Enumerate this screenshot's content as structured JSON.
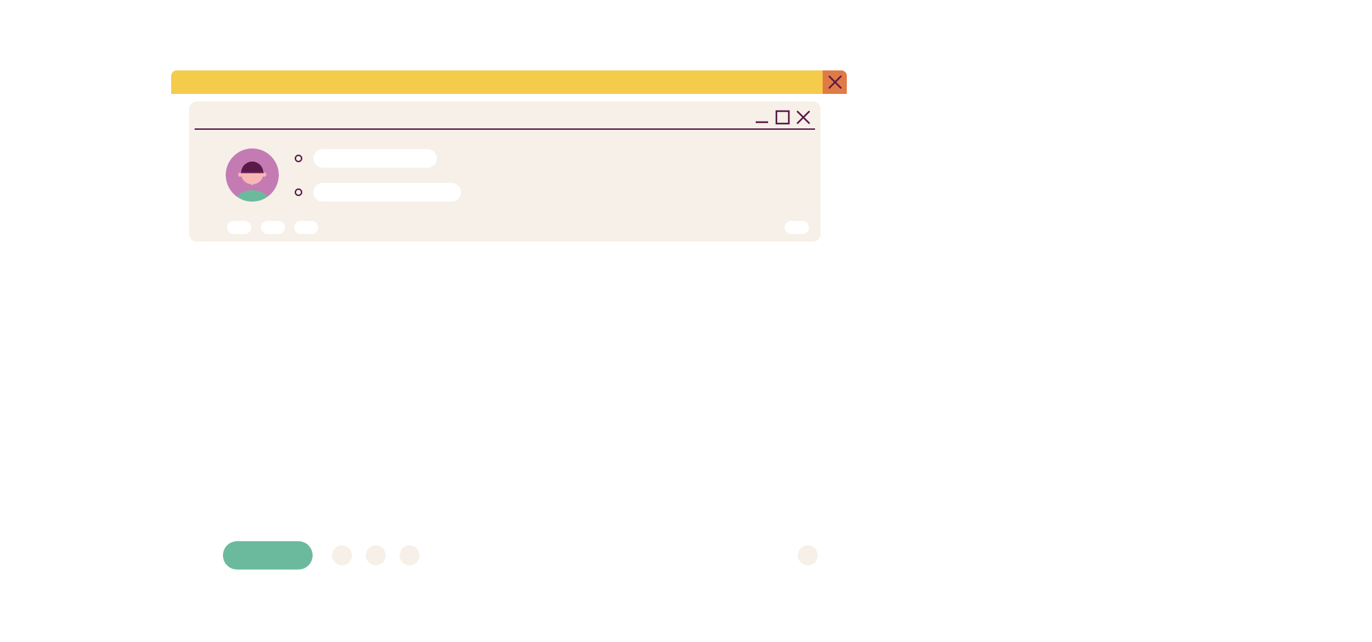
{
  "colors": {
    "titlebar": "#f5cb4b",
    "close_button": "#e07b46",
    "panel_background": "#f6f0e9",
    "accent_dark": "#5a1a47",
    "primary_button": "#6bba9d",
    "placeholder_pill": "#ffffff",
    "avatar_background": "#c47bb4",
    "avatar_skin": "#f7b7b4",
    "avatar_shirt": "#6bba9d"
  },
  "window": {
    "close_icon": "close-icon",
    "panel": {
      "minimize_icon": "minimize-icon",
      "maximize_icon": "maximize-icon",
      "close_icon": "close-icon"
    }
  },
  "profile": {
    "avatar_icon": "user-avatar-icon",
    "options": [
      {
        "label": ""
      },
      {
        "label": ""
      }
    ]
  },
  "chips": [
    {
      "label": ""
    },
    {
      "label": ""
    },
    {
      "label": ""
    },
    {
      "label": ""
    }
  ],
  "footer": {
    "primary_label": "",
    "dots": [
      "",
      "",
      "",
      ""
    ]
  }
}
